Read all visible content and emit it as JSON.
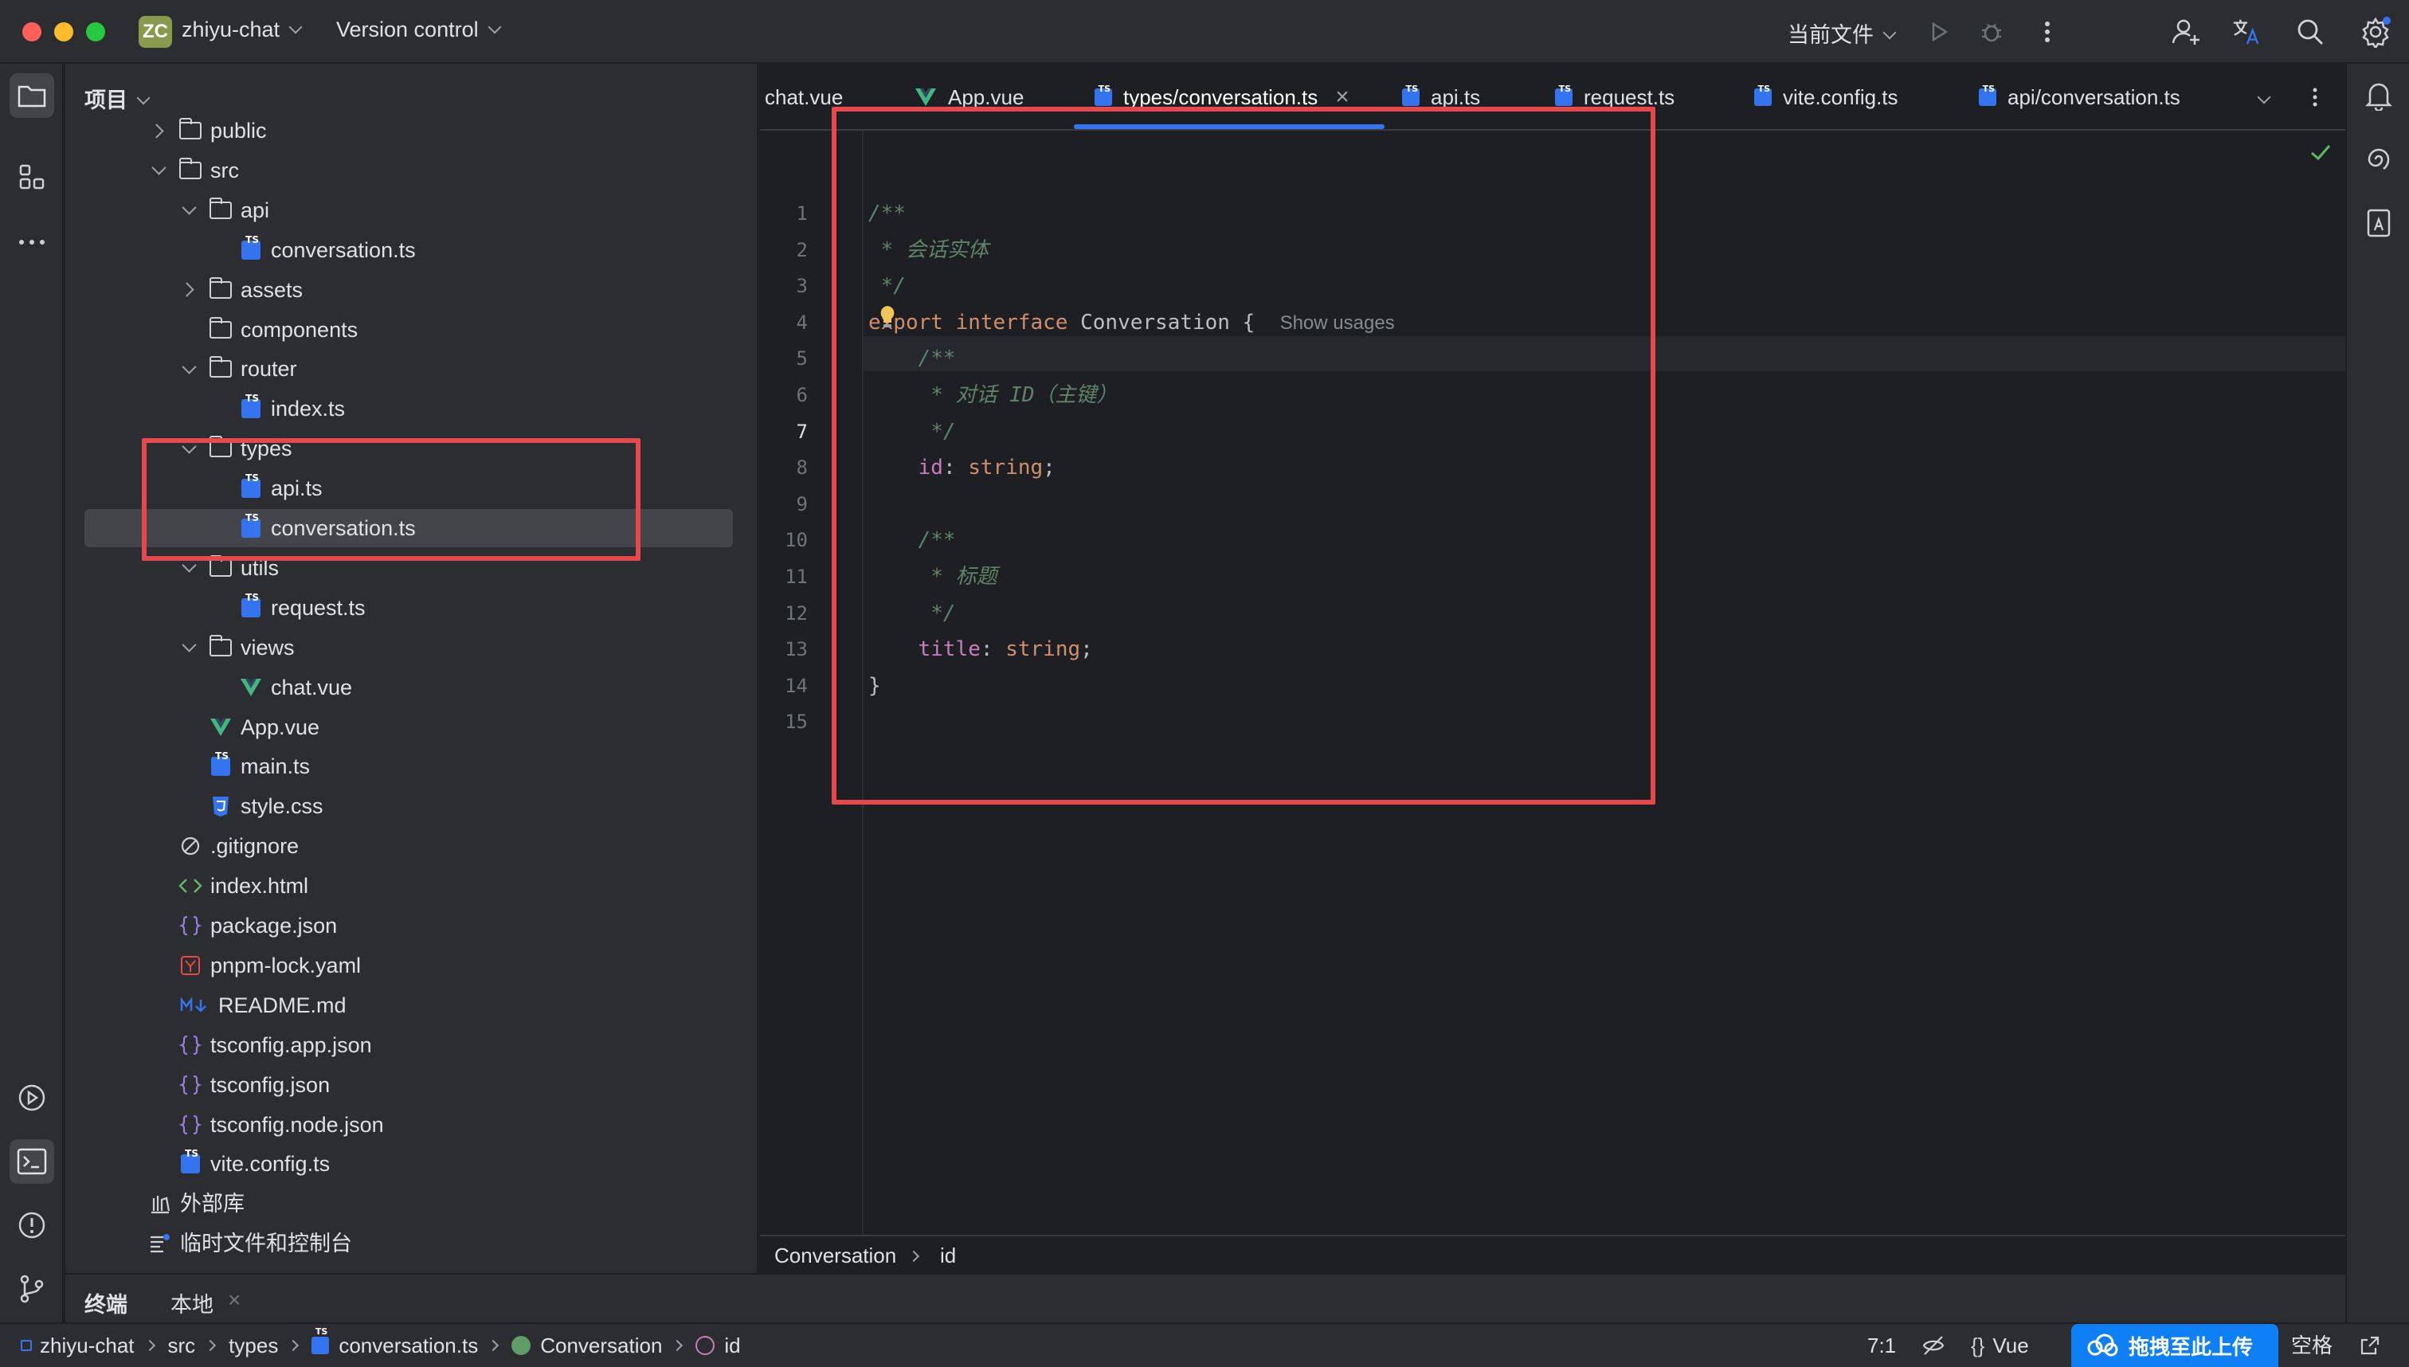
{
  "window": {
    "project_badge": "ZC",
    "project_name": "zhiyu-chat",
    "vcs_label": "Version control",
    "run_config": "当前文件"
  },
  "project_panel": {
    "title": "项目",
    "tree": [
      {
        "label": "public",
        "depth": 1,
        "arrow": "right",
        "icon": "folder"
      },
      {
        "label": "src",
        "depth": 1,
        "arrow": "down",
        "icon": "folder"
      },
      {
        "label": "api",
        "depth": 2,
        "arrow": "down",
        "icon": "folder"
      },
      {
        "label": "conversation.ts",
        "depth": 3,
        "arrow": "none",
        "icon": "ts"
      },
      {
        "label": "assets",
        "depth": 2,
        "arrow": "right",
        "icon": "folder"
      },
      {
        "label": "components",
        "depth": 2,
        "arrow": "none",
        "icon": "folder"
      },
      {
        "label": "router",
        "depth": 2,
        "arrow": "down",
        "icon": "folder"
      },
      {
        "label": "index.ts",
        "depth": 3,
        "arrow": "none",
        "icon": "ts"
      },
      {
        "label": "types",
        "depth": 2,
        "arrow": "down",
        "icon": "folder"
      },
      {
        "label": "api.ts",
        "depth": 3,
        "arrow": "none",
        "icon": "ts"
      },
      {
        "label": "conversation.ts",
        "depth": 3,
        "arrow": "none",
        "icon": "ts",
        "selected": true
      },
      {
        "label": "utils",
        "depth": 2,
        "arrow": "down",
        "icon": "folder"
      },
      {
        "label": "request.ts",
        "depth": 3,
        "arrow": "none",
        "icon": "ts"
      },
      {
        "label": "views",
        "depth": 2,
        "arrow": "down",
        "icon": "folder"
      },
      {
        "label": "chat.vue",
        "depth": 3,
        "arrow": "none",
        "icon": "vue"
      },
      {
        "label": "App.vue",
        "depth": 2,
        "arrow": "none",
        "icon": "vue"
      },
      {
        "label": "main.ts",
        "depth": 2,
        "arrow": "none",
        "icon": "ts"
      },
      {
        "label": "style.css",
        "depth": 2,
        "arrow": "none",
        "icon": "css"
      },
      {
        "label": ".gitignore",
        "depth": 1,
        "arrow": "none",
        "icon": "ignore"
      },
      {
        "label": "index.html",
        "depth": 1,
        "arrow": "none",
        "icon": "html"
      },
      {
        "label": "package.json",
        "depth": 1,
        "arrow": "none",
        "icon": "json"
      },
      {
        "label": "pnpm-lock.yaml",
        "depth": 1,
        "arrow": "none",
        "icon": "yaml"
      },
      {
        "label": "README.md",
        "depth": 1,
        "arrow": "none",
        "icon": "md"
      },
      {
        "label": "tsconfig.app.json",
        "depth": 1,
        "arrow": "none",
        "icon": "json"
      },
      {
        "label": "tsconfig.json",
        "depth": 1,
        "arrow": "none",
        "icon": "json"
      },
      {
        "label": "tsconfig.node.json",
        "depth": 1,
        "arrow": "none",
        "icon": "json"
      },
      {
        "label": "vite.config.ts",
        "depth": 1,
        "arrow": "none",
        "icon": "ts"
      },
      {
        "label": "外部库",
        "depth": 0,
        "arrow": "none",
        "icon": "library"
      },
      {
        "label": "临时文件和控制台",
        "depth": 0,
        "arrow": "none",
        "icon": "scratch"
      }
    ]
  },
  "tabs": [
    {
      "label": "chat.vue",
      "icon": "none"
    },
    {
      "label": "App.vue",
      "icon": "vue"
    },
    {
      "label": "types/conversation.ts",
      "icon": "ts",
      "active": true
    },
    {
      "label": "api.ts",
      "icon": "ts"
    },
    {
      "label": "request.ts",
      "icon": "ts"
    },
    {
      "label": "vite.config.ts",
      "icon": "ts"
    },
    {
      "label": "api/conversation.ts",
      "icon": "ts"
    }
  ],
  "editor": {
    "current_line": 7,
    "lines": [
      [
        {
          "t": "/**",
          "c": "doc"
        }
      ],
      [
        {
          "t": " * 会话实体",
          "c": "doc"
        }
      ],
      [
        {
          "t": " */",
          "c": "doc"
        }
      ],
      [
        {
          "t": "export ",
          "c": "kw"
        },
        {
          "t": "interface ",
          "c": "kw"
        },
        {
          "t": "Conversation {  ",
          "c": ""
        },
        {
          "t": "Show usages",
          "c": "hint"
        }
      ],
      [
        {
          "t": "    /**",
          "c": "doc"
        }
      ],
      [
        {
          "t": "     * 对话 ",
          "c": "doc"
        },
        {
          "t": "ID",
          "c": "doc"
        },
        {
          "t": "（主键）",
          "c": "doc"
        }
      ],
      [
        {
          "t": "     */",
          "c": "doc"
        }
      ],
      [
        {
          "t": "    ",
          "c": ""
        },
        {
          "t": "id",
          "c": "prop"
        },
        {
          "t": ": ",
          "c": ""
        },
        {
          "t": "string",
          "c": "type"
        },
        {
          "t": ";",
          "c": ""
        }
      ],
      [],
      [
        {
          "t": "    /**",
          "c": "doc"
        }
      ],
      [
        {
          "t": "     * 标题",
          "c": "doc"
        }
      ],
      [
        {
          "t": "     */",
          "c": "doc"
        }
      ],
      [
        {
          "t": "    ",
          "c": ""
        },
        {
          "t": "title",
          "c": "prop"
        },
        {
          "t": ": ",
          "c": ""
        },
        {
          "t": "string",
          "c": "type"
        },
        {
          "t": ";",
          "c": ""
        }
      ],
      [
        {
          "t": "}",
          "c": ""
        }
      ],
      []
    ]
  },
  "editor_breadcrumb": [
    "Conversation",
    "id"
  ],
  "bottom_panel": {
    "tab_terminal": "终端",
    "tab_local": "本地"
  },
  "status_bar": {
    "path": [
      "zhiyu-chat",
      "src",
      "types",
      "conversation.ts",
      "Conversation",
      "id"
    ],
    "caret": "7:1",
    "lang": "Vue",
    "indent": "空格",
    "upload_label": "拖拽至此上传"
  },
  "colors": {
    "accent": "#3574f0",
    "annotation": "#e5484d",
    "upload": "#0f7ff6"
  }
}
